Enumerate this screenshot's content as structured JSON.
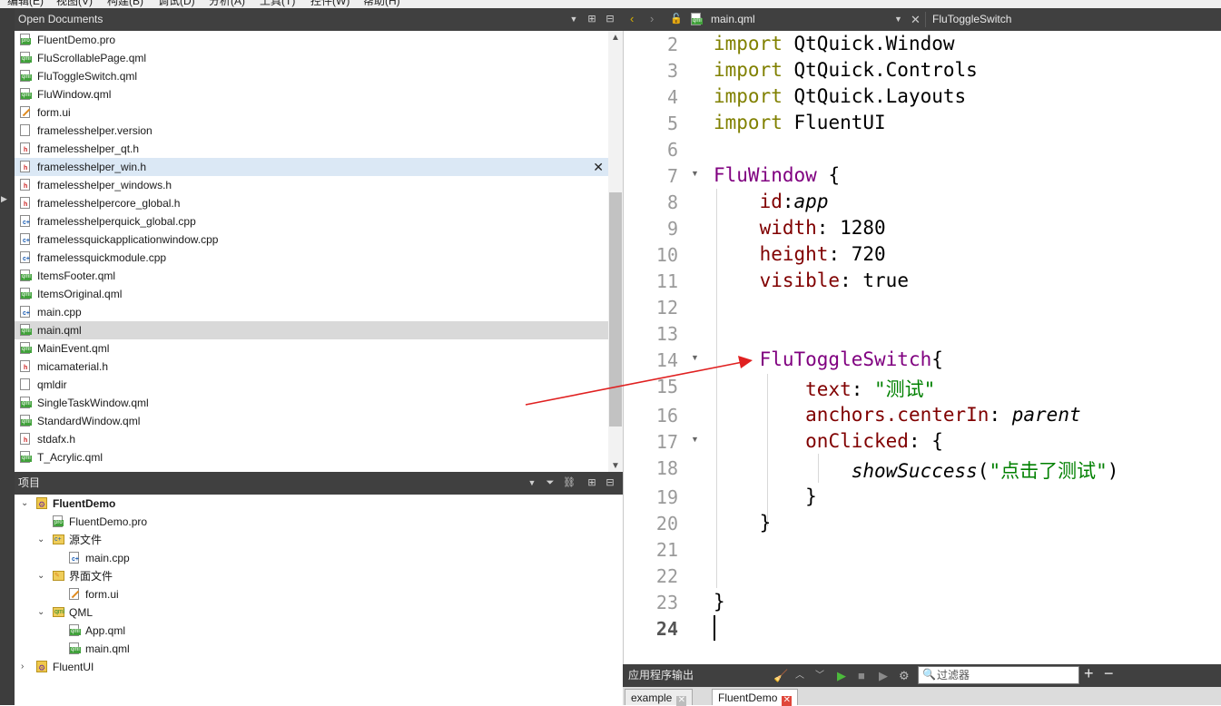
{
  "menu_items": [
    "编辑(E)",
    "视图(V)",
    "构建(B)",
    "调试(D)",
    "分析(A)",
    "工具(T)",
    "控件(W)",
    "帮助(H)"
  ],
  "open_documents": {
    "title": "Open Documents",
    "files": [
      {
        "name": "FluentDemo.pro",
        "icon": "pro-file-icon"
      },
      {
        "name": "FluScrollablePage.qml",
        "icon": "qml-file-icon"
      },
      {
        "name": "FluToggleSwitch.qml",
        "icon": "qml-file-icon"
      },
      {
        "name": "FluWindow.qml",
        "icon": "qml-file-icon"
      },
      {
        "name": "form.ui",
        "icon": "ui-file-icon"
      },
      {
        "name": "framelesshelper.version",
        "icon": "text-file-icon"
      },
      {
        "name": "framelesshelper_qt.h",
        "icon": "header-file-icon"
      },
      {
        "name": "framelesshelper_win.h",
        "icon": "header-file-icon",
        "state": "hover"
      },
      {
        "name": "framelesshelper_windows.h",
        "icon": "header-file-icon"
      },
      {
        "name": "framelesshelpercore_global.h",
        "icon": "header-file-icon"
      },
      {
        "name": "framelesshelperquick_global.cpp",
        "icon": "cpp-file-icon"
      },
      {
        "name": "framelessquickapplicationwindow.cpp",
        "icon": "cpp-file-icon"
      },
      {
        "name": "framelessquickmodule.cpp",
        "icon": "cpp-file-icon"
      },
      {
        "name": "ItemsFooter.qml",
        "icon": "qml-file-icon"
      },
      {
        "name": "ItemsOriginal.qml",
        "icon": "qml-file-icon"
      },
      {
        "name": "main.cpp",
        "icon": "cpp-file-icon"
      },
      {
        "name": "main.qml",
        "icon": "qml-file-icon",
        "state": "selected"
      },
      {
        "name": "MainEvent.qml",
        "icon": "qml-file-icon"
      },
      {
        "name": "micamaterial.h",
        "icon": "header-file-icon"
      },
      {
        "name": "qmldir",
        "icon": "text-file-icon"
      },
      {
        "name": "SingleTaskWindow.qml",
        "icon": "qml-file-icon"
      },
      {
        "name": "StandardWindow.qml",
        "icon": "qml-file-icon"
      },
      {
        "name": "stdafx.h",
        "icon": "header-file-icon"
      },
      {
        "name": "T_Acrylic.qml",
        "icon": "qml-file-icon"
      }
    ],
    "close_glyph": "✕"
  },
  "project": {
    "title": "项目",
    "tree": [
      {
        "label": "FluentDemo",
        "bold": true,
        "expanded": true,
        "icon": "project-icon"
      },
      {
        "label": "FluentDemo.pro",
        "icon": "pro-file-icon"
      },
      {
        "label": "源文件",
        "expanded": true,
        "icon": "folder-icon"
      },
      {
        "label": "main.cpp",
        "icon": "cpp-file-icon"
      },
      {
        "label": "界面文件",
        "expanded": true,
        "icon": "folder-icon"
      },
      {
        "label": "form.ui",
        "icon": "ui-file-icon"
      },
      {
        "label": "QML",
        "expanded": true,
        "icon": "folder-icon"
      },
      {
        "label": "App.qml",
        "icon": "qml-file-icon"
      },
      {
        "label": "main.qml",
        "icon": "qml-file-icon"
      },
      {
        "label": "FluentUI",
        "expanded": false,
        "icon": "project-icon"
      }
    ]
  },
  "editor": {
    "file_name": "main.qml",
    "symbol": "FluToggleSwitch",
    "current_line": "24",
    "lines": [
      {
        "n": "2",
        "text": "import QtQuick.Window"
      },
      {
        "n": "3",
        "text": "import QtQuick.Controls"
      },
      {
        "n": "4",
        "text": "import QtQuick.Layouts"
      },
      {
        "n": "5",
        "text": "import FluentUI"
      },
      {
        "n": "6",
        "text": ""
      },
      {
        "n": "7",
        "text": "FluWindow {",
        "fold": true
      },
      {
        "n": "8",
        "text": "    id:app"
      },
      {
        "n": "9",
        "text": "    width: 1280"
      },
      {
        "n": "10",
        "text": "    height: 720"
      },
      {
        "n": "11",
        "text": "    visible: true"
      },
      {
        "n": "12",
        "text": ""
      },
      {
        "n": "13",
        "text": ""
      },
      {
        "n": "14",
        "text": "    FluToggleSwitch{",
        "fold": true
      },
      {
        "n": "15",
        "text": "        text: \"测试\""
      },
      {
        "n": "16",
        "text": "        anchors.centerIn: parent"
      },
      {
        "n": "17",
        "text": "        onClicked: {",
        "fold": true
      },
      {
        "n": "18",
        "text": "            showSuccess(\"点击了测试\")"
      },
      {
        "n": "19",
        "text": "        }"
      },
      {
        "n": "20",
        "text": "    }"
      },
      {
        "n": "21",
        "text": ""
      },
      {
        "n": "22",
        "text": ""
      },
      {
        "n": "23",
        "text": "}"
      },
      {
        "n": "24",
        "text": ""
      }
    ]
  },
  "output": {
    "title": "应用程序输出",
    "filter_placeholder": "过滤器",
    "add_label": "+",
    "remove_label": "−",
    "tabs": [
      {
        "label": "example",
        "active": false
      },
      {
        "label": "FluentDemo",
        "active": true
      }
    ]
  },
  "colors": {
    "keyword": "#808000",
    "type": "#800080",
    "property": "#800000",
    "string": "#008000",
    "annotation_arrow": "#e02020"
  }
}
